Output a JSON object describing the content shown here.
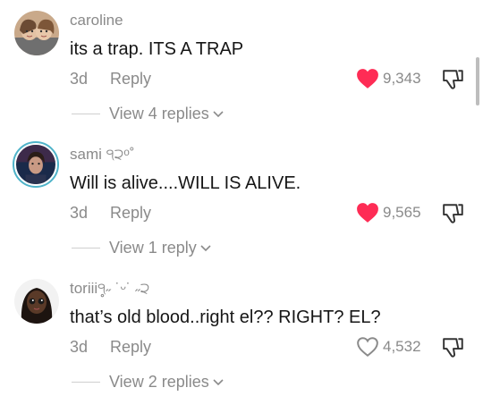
{
  "comments": [
    {
      "username": "caroline",
      "text": "its a trap. ITS A TRAP",
      "time": "3d",
      "reply_label": "Reply",
      "likes": "9,343",
      "liked": true,
      "view_replies": "View 4 replies",
      "avatar_icon": "profile-photo-two-people"
    },
    {
      "username": "sami ੧੨ᵒ˚",
      "text": "Will is alive....WILL IS ALIVE.",
      "time": "3d",
      "reply_label": "Reply",
      "likes": "9,565",
      "liked": true,
      "view_replies": "View 1 reply",
      "avatar_icon": "profile-photo-with-story-ring"
    },
    {
      "username": "toriii੧̥˶ ˙ᵕ˙ ˶੨",
      "text": "that’s old blood..right el?? RIGHT? EL?",
      "time": "3d",
      "reply_label": "Reply",
      "likes": "4,532",
      "liked": false,
      "view_replies": "View 2 replies",
      "avatar_icon": "profile-photo-doll"
    }
  ],
  "colors": {
    "liked_heart": "#fe2c55",
    "muted_text": "#8a8a8a",
    "body_text": "#161616"
  }
}
